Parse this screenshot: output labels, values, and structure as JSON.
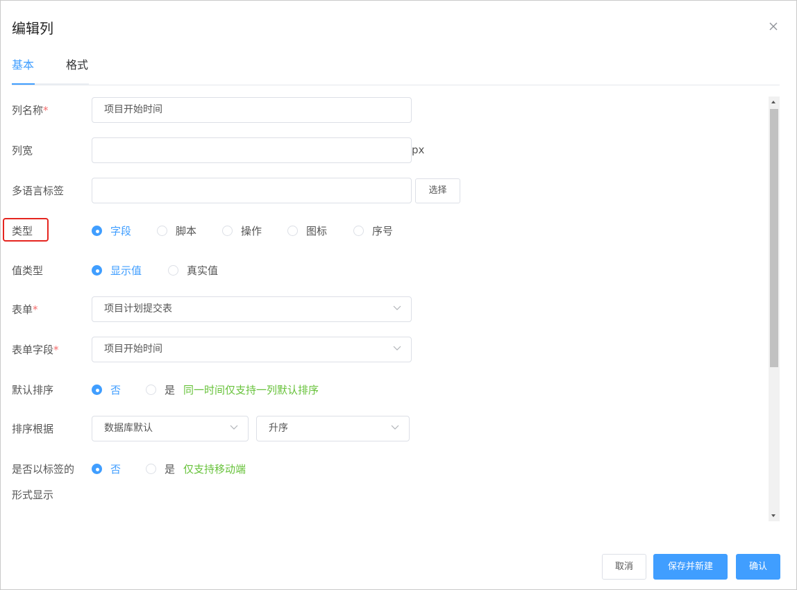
{
  "dialog": {
    "title": "编辑列"
  },
  "tabs": [
    {
      "label": "基本",
      "active": true
    },
    {
      "label": "格式",
      "active": false
    }
  ],
  "form": {
    "column_name": {
      "label": "列名称",
      "required_mark": "*",
      "value": "项目开始时间"
    },
    "column_width": {
      "label": "列宽",
      "value": "",
      "unit": "px"
    },
    "i18n_label": {
      "label": "多语言标签",
      "value": "",
      "button": "选择"
    },
    "type": {
      "label": "类型",
      "options": [
        "字段",
        "脚本",
        "操作",
        "图标",
        "序号"
      ],
      "selected": "字段"
    },
    "value_type": {
      "label": "值类型",
      "options": [
        "显示值",
        "真实值"
      ],
      "selected": "显示值"
    },
    "form_select": {
      "label": "表单",
      "required_mark": "*",
      "value": "项目计划提交表"
    },
    "form_field": {
      "label": "表单字段",
      "required_mark": "*",
      "value": "项目开始时间"
    },
    "default_sort": {
      "label": "默认排序",
      "options": [
        "否",
        "是"
      ],
      "selected": "否",
      "hint": "同一时间仅支持一列默认排序"
    },
    "sort_basis": {
      "label": "排序根据",
      "basis_value": "数据库默认",
      "order_value": "升序"
    },
    "show_as_tag": {
      "label_line1": "是否以标签的",
      "label_line2": "形式显示",
      "options": [
        "否",
        "是"
      ],
      "selected": "否",
      "hint": "仅支持移动端"
    }
  },
  "footer": {
    "cancel": "取消",
    "save_new": "保存并新建",
    "confirm": "确认"
  },
  "colors": {
    "primary": "#409eff",
    "required": "#f56c6c",
    "hint": "#67c23a",
    "highlight": "#e5251f"
  }
}
